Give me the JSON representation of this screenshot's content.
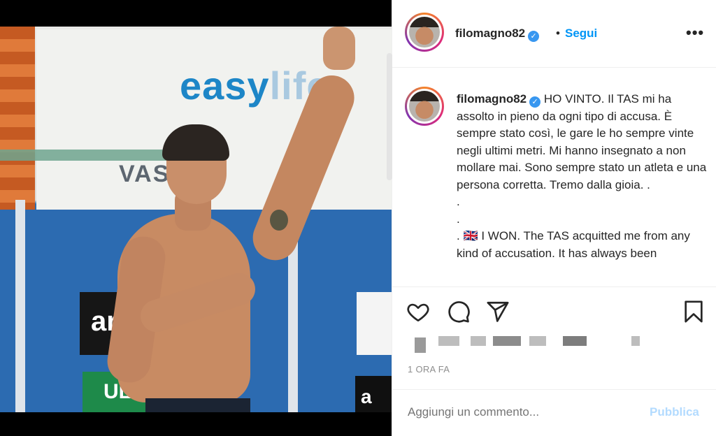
{
  "photo": {
    "banner_brand": "easy",
    "banner_brand_faded": "life",
    "banner_sub": "VAS",
    "sign_dark": "ar",
    "sign_green": "ULI",
    "sign_right": "a"
  },
  "header": {
    "username": "filomagno82",
    "verified_symbol": "✓",
    "separator": "•",
    "follow_label": "Segui",
    "more_label": "•••"
  },
  "caption": {
    "username": "filomagno82",
    "text": " HO VINTO. Il TAS mi ha assolto in pieno da ogni tipo di accusa. È sempre stato così, le gare le ho sempre vinte negli ultimi metri. Mi hanno insegnato a non mollare mai. Sono sempre stato un atleta e una persona corretta. Tremo dalla gioia. .",
    "dot1": ".",
    "dot2": ".",
    "english": ". 🇬🇧 I WON. The TAS acquitted me from any kind of accusation. It has always been"
  },
  "actions": {
    "like_icon": "heart-icon",
    "comment_icon": "comment-icon",
    "share_icon": "share-icon",
    "save_icon": "bookmark-icon"
  },
  "meta": {
    "time": "1 ORA FA"
  },
  "comment_box": {
    "placeholder": "Aggiungi un commento...",
    "publish_label": "Pubblica"
  },
  "colors": {
    "accent": "#0095f6",
    "publish_disabled": "#b3dbff",
    "text": "#262626",
    "muted": "#8e8e8e"
  }
}
